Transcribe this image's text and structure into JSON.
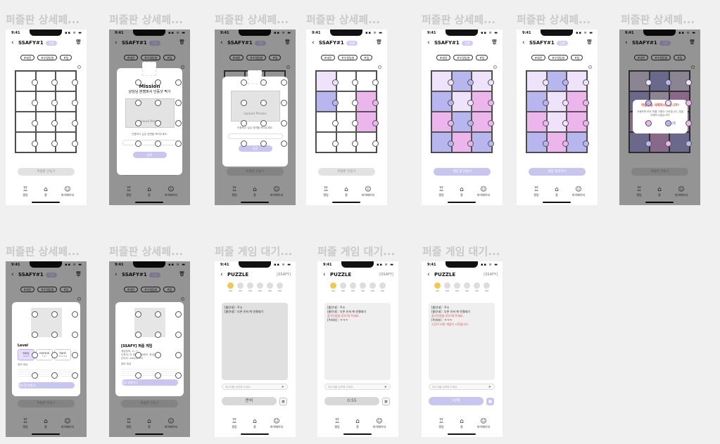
{
  "frame_titles": {
    "r1": [
      "퍼즐판 상세페...",
      "퍼즐판 상세페...",
      "퍼즐판 상세페...",
      "퍼즐판 상세페...",
      "퍼즐판 상세페...",
      "퍼즐판 상세페...",
      "퍼즐판 상세페..."
    ],
    "r2": [
      "퍼즐판 상세페...",
      "퍼즐판 상세페...",
      "퍼즐 게임 대기...",
      "퍼즐 게임 대기...",
      "퍼즐 게임 대기..."
    ]
  },
  "status": {
    "time": "9:41",
    "indicators": "▪▪ ≋ ▬"
  },
  "header": {
    "title": "SSAFY#1",
    "badge": "진행",
    "puzzle_title": "PUZZLE",
    "puzzle_right": "[SSAFY]",
    "back": "‹",
    "trash": "🗑"
  },
  "tags": [
    "#대전",
    "#우정팀원",
    "#팀"
  ],
  "buttons": {
    "make_puzzle": "퍼즐판 만들기",
    "start_game": "게임 참 만들기",
    "game_enter": "게임 참여하기",
    "ready": "준비",
    "timer": "0:55",
    "start": "시작",
    "confirm": "등록",
    "cancel": "취소",
    "delete": "삭제",
    "img": "▣"
  },
  "nav": [
    {
      "icon": "♖",
      "label": "랭킹"
    },
    {
      "icon": "⌂",
      "label": "홈"
    },
    {
      "icon": "☺",
      "label": "마이페이지"
    }
  ],
  "mission": {
    "title": "Mission",
    "subtitle": "상당님 본캠퍼서 인증샷 찍기",
    "upload": "Upload Photos",
    "desc": "인증하고 싶은 장면을 찍어주세요.",
    "desc2": "인증하고 싶은 장면을 찍어주세요."
  },
  "delete_modal": {
    "title": "퍼즐판을 삭제하시겠습니까?",
    "body": "삭제하면 모든 퍼즐 기록이 사라집니다. 정말 삭제하시겠습니까?"
  },
  "level": {
    "label": "Level",
    "options": [
      {
        "name": "easy",
        "sub": "5×5"
      },
      {
        "name": "normal",
        "sub": "7×7"
      },
      {
        "name": "hard",
        "sub": "10×10"
      }
    ],
    "desc_title": "참여 대상"
  },
  "game_info": {
    "title": "[SSAFY] 퍼즐 게임",
    "lines": [
      "게임참여: 2 / 7",
      "주최자: 이 대전 봄 라운드 게 팀",
      "난이도: easy(5×5)"
    ],
    "sub": "참여 대상"
  },
  "players": [
    "4/4",
    "0/0",
    "0/0",
    "0/0",
    "0/0",
    "0/0"
  ],
  "chat": {
    "line1": "[룸안내] : 주소",
    "line2": "[룸안내] : 다른 유저 에 연결대기",
    "red": "참가인원을 준비 해 주세요.",
    "line3": "[주최자] : ㅋㅋㅋ",
    "red2": "시간이 되면 게임이 시작됩니다.",
    "placeholder": "메시지를 입력해 주세요.",
    "send": "➤"
  }
}
